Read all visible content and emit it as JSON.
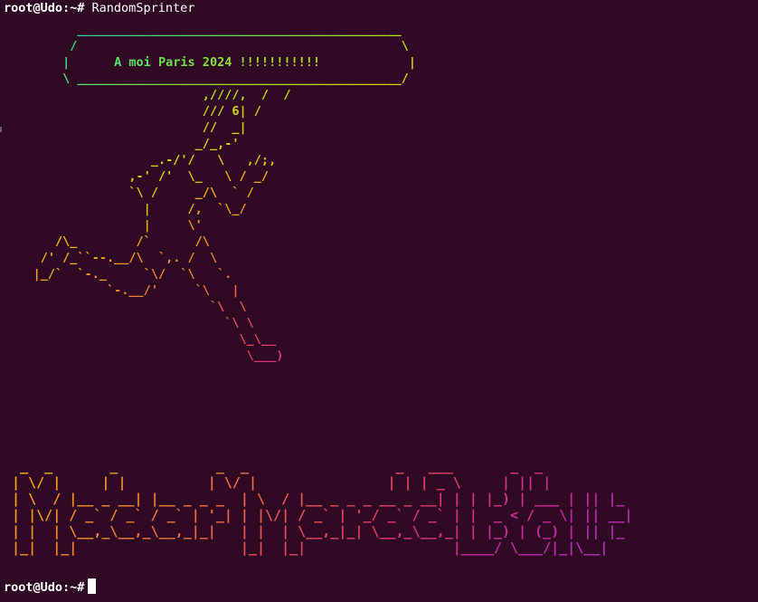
{
  "terminal": {
    "prompt": "root@Udo:~#",
    "command": "RandomSprinter",
    "current_prompt": "root@Udo:~#"
  },
  "speech_bubble": {
    "text": "A moi Paris 2024 !!!!!!!!!!!",
    "lines": [
      "          ____________________________________________",
      "         /                                            \\",
      "        |      A moi Paris 2024 !!!!!!!!!!!            |",
      "        \\ ____________________________________________/",
      "                                      /"
    ]
  },
  "sprinter_art": {
    "lines": [
      "                           ,////,  /",
      "                           /// 6| /",
      "                           //  _|",
      "                          _/_,-'",
      "                    _.-/'/   \\   ,/;,",
      "                 ,-' /'  \\_   \\ / _/",
      "                 `\\ /     _/\\  ` /",
      "                   |     /,  `\\_/",
      "                   |     \\'",
      "       /\\_        /`      /\\",
      "     /' /_``--.__/\\  `,. /  \\",
      "    |_/`  `-._     `\\/  `\\   `.",
      "              `-.__/'     `\\   |",
      "                            `\\  \\",
      "                              `\\ \\",
      "                                \\_\\__",
      "                                 \\___)"
    ]
  },
  "banner_art": {
    "text": "Madar Marad Bolt",
    "lines": [
      "  _  _       _            _  _                  _   ___       _  _",
      " | \\/ |     | |          | \\/ |                | | | _ \\     | || |",
      " | \\  / |__ _ __| |__ _ _ _  | \\  / |__ _ _ _ __ _ __| | | |_) | ___ | || |_",
      " | |\\/| / _` / _` / _` | '_| | |\\/| / _` | '_/ _` / _` | |  _ < / _ \\| || __|",
      " | |  | \\__,_\\__,_\\__,_|_|   | |  | \\__,_|_| \\__,_\\__,_| | |_) | (_) | || |_",
      " |_|  |_|                    |_|  |_|                  |____/ \\___/|_|\\__|"
    ]
  },
  "colors": {
    "background": "#300a24",
    "prompt_text": "#ffffff",
    "gradient": [
      "#17c3c3",
      "#4ee26a",
      "#a7e01f",
      "#e8d000",
      "#f59a1a",
      "#f06a3c",
      "#e2386e",
      "#c626a6",
      "#9a3ad8",
      "#6a4ef0"
    ]
  }
}
